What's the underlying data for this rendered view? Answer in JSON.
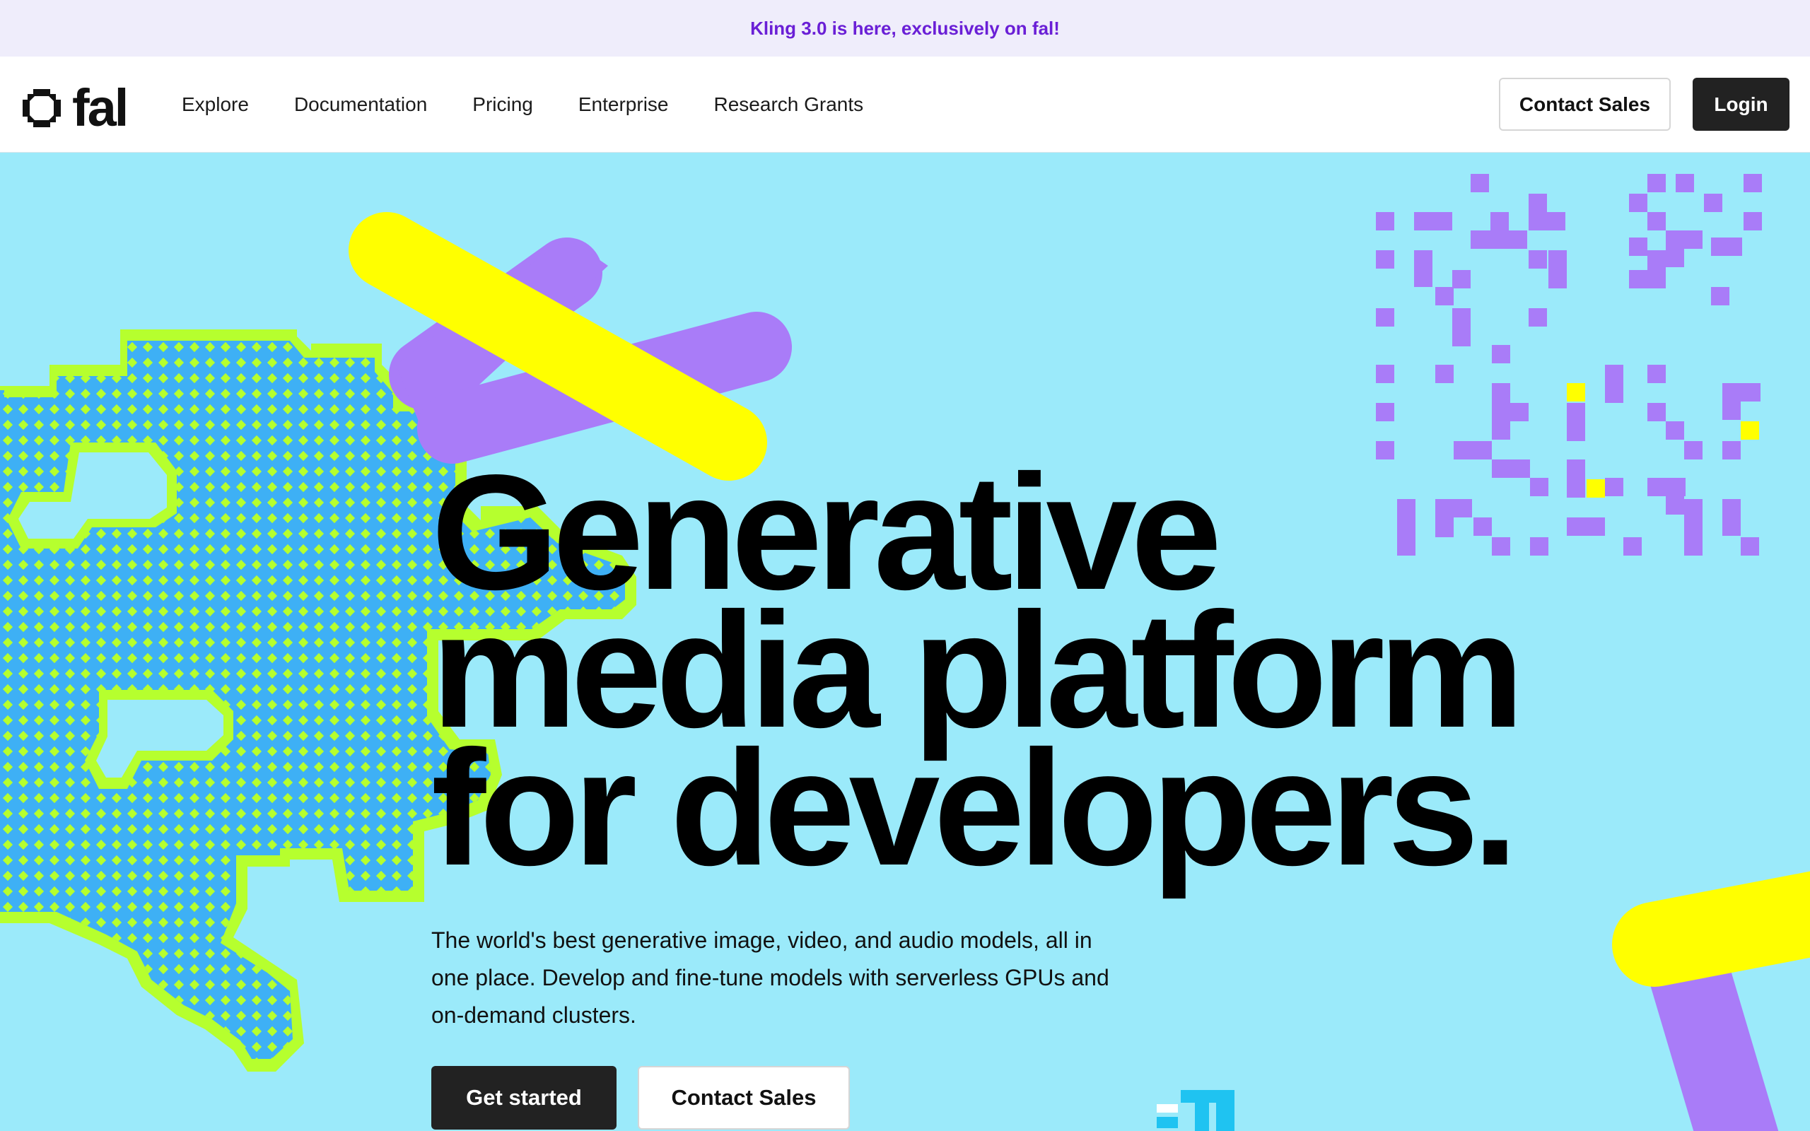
{
  "announcement": {
    "text": "Kling 3.0 is here, exclusively on fal!"
  },
  "brand": {
    "name": "fal",
    "logo_icon": "octagon-ring-icon"
  },
  "nav": {
    "links": [
      {
        "label": "Explore"
      },
      {
        "label": "Documentation"
      },
      {
        "label": "Pricing"
      },
      {
        "label": "Enterprise"
      },
      {
        "label": "Research Grants"
      }
    ],
    "contact_label": "Contact Sales",
    "login_label": "Login"
  },
  "hero": {
    "headline_lines": [
      "Generative",
      "media platform",
      "for developers."
    ],
    "subcopy": "The world's best generative image, video, and audio models, all in one place. Develop and fine-tune models with serverless GPUs and on-demand clusters.",
    "primary_cta": "Get started",
    "secondary_cta": "Contact Sales"
  },
  "colors": {
    "hero_bg": "#9beafa",
    "announcement_bg": "#efedfb",
    "announcement_text": "#6a1fd6",
    "accent_yellow": "#ffff00",
    "accent_purple": "#a97cf8",
    "accent_lime": "#b6ff2e",
    "accent_blue": "#3eb0f5"
  }
}
